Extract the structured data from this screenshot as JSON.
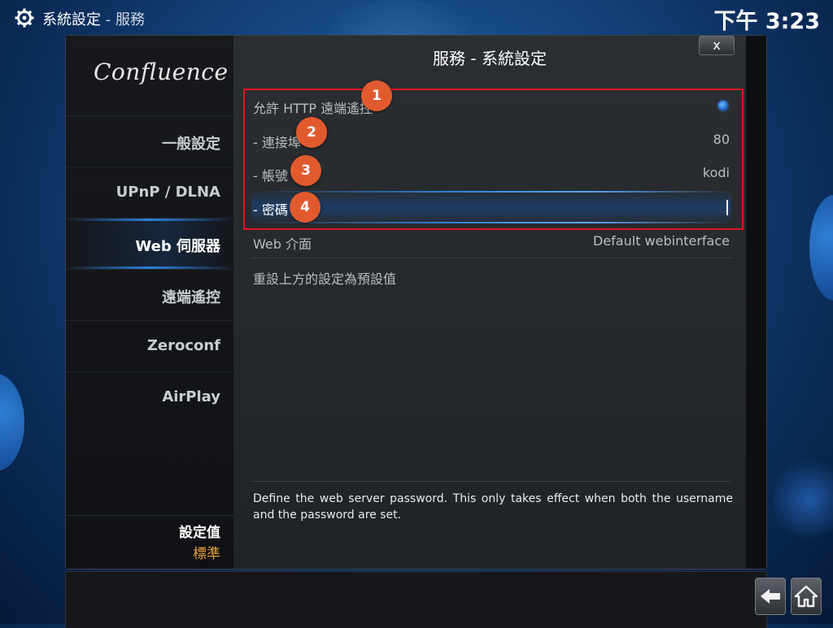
{
  "topbar": {
    "breadcrumb_main": "系統設定",
    "breadcrumb_sep": " - ",
    "breadcrumb_sub": "服務",
    "clock": "下午 3:23"
  },
  "sidebar": {
    "logo": "Confluence",
    "items": [
      {
        "label": "一般設定"
      },
      {
        "label": "UPnP / DLNA"
      },
      {
        "label": "Web 伺服器",
        "active": true
      },
      {
        "label": "遠端遙控"
      },
      {
        "label": "Zeroconf"
      },
      {
        "label": "AirPlay"
      }
    ],
    "setting_level_title": "設定值",
    "setting_level_value": "標準"
  },
  "dialog": {
    "title": "服務 - 系統設定",
    "close_label": "x"
  },
  "settings": [
    {
      "label": "允許 HTTP 遠端遙控",
      "value": "",
      "type": "radio",
      "marker": "1"
    },
    {
      "label": "- 連接埠",
      "value": "80",
      "marker": "2"
    },
    {
      "label": "- 帳號",
      "value": "kodi",
      "marker": "3"
    },
    {
      "label": "- 密碼",
      "value": "",
      "type": "text-focused",
      "marker": "4"
    },
    {
      "label": "Web 介面",
      "value": "Default webinterface"
    },
    {
      "label": "重設上方的設定為預設值",
      "value": ""
    }
  ],
  "description": "Define the web server password. This only takes effect when both the username and the password are set.",
  "colors": {
    "accent": "#2d7fd8",
    "highlight_box": "#e0161f",
    "marker": "#e15a2e",
    "level_value": "#e8a13b"
  },
  "icons": [
    "gear-icon",
    "back-arrow-icon",
    "home-icon",
    "radio-on-icon"
  ]
}
